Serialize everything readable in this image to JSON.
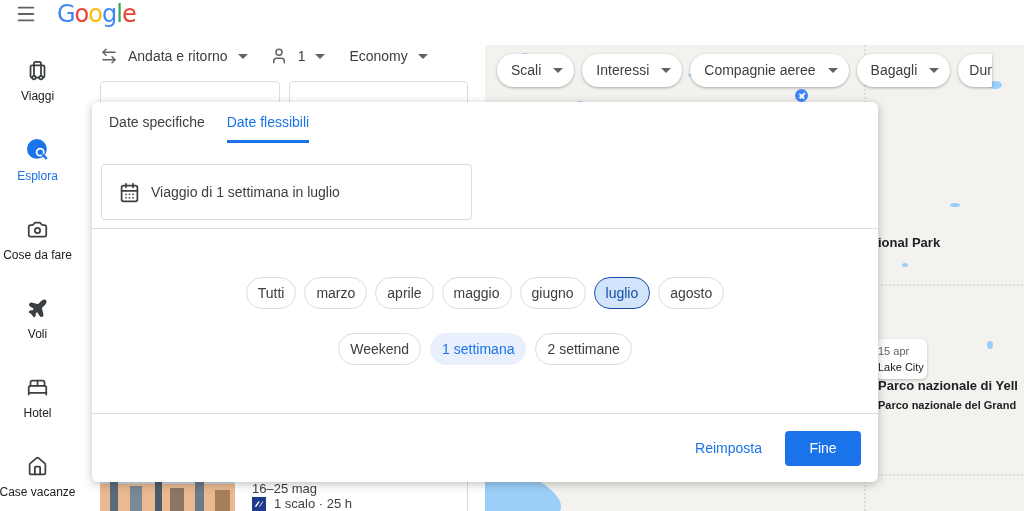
{
  "header": {
    "logo": "Google"
  },
  "sidebar": {
    "items": [
      {
        "kind": "trips",
        "label": "Viaggi",
        "selected": false
      },
      {
        "kind": "explore",
        "label": "Esplora",
        "selected": true
      },
      {
        "kind": "things",
        "label": "Cose da fare",
        "selected": false
      },
      {
        "kind": "flights",
        "label": "Voli",
        "selected": false
      },
      {
        "kind": "hotels",
        "label": "Hotel",
        "selected": false
      },
      {
        "kind": "rentals",
        "label": "Case vacanze",
        "selected": false
      }
    ]
  },
  "trip_bar": {
    "trip_type": "Andata e ritorno",
    "passengers": "1",
    "cabin_class": "Economy"
  },
  "result_card": {
    "dates": "16–25 mag",
    "details": "1 scalo · 25 h"
  },
  "map": {
    "filters": [
      "Scali",
      "Interessi",
      "Compagnie aeree",
      "Bagagli",
      "Dur"
    ],
    "labels": [
      {
        "kind": "park",
        "text": "ional Park"
      },
      {
        "kind": "park",
        "text": "Parco nazionale di Yell"
      },
      {
        "kind": "small",
        "text": "Parco nazionale del Grand"
      }
    ],
    "price_card": {
      "date": "15 apr",
      "place": "Lake City"
    }
  },
  "date_picker": {
    "tabs": [
      {
        "label": "Date specifiche",
        "selected": false
      },
      {
        "label": "Date flessibili",
        "selected": true
      }
    ],
    "summary": "Viaggio di 1 settimana in luglio",
    "months": [
      {
        "label": "Tutti",
        "selected": false
      },
      {
        "label": "marzo",
        "selected": false
      },
      {
        "label": "aprile",
        "selected": false
      },
      {
        "label": "maggio",
        "selected": false
      },
      {
        "label": "giugno",
        "selected": false
      },
      {
        "label": "luglio",
        "selected": true
      },
      {
        "label": "agosto",
        "selected": false
      }
    ],
    "durations": [
      {
        "label": "Weekend",
        "selected": false
      },
      {
        "label": "1 settimana",
        "selected": true
      },
      {
        "label": "2 settimane",
        "selected": false
      }
    ],
    "reset": "Reimposta",
    "done": "Fine"
  }
}
